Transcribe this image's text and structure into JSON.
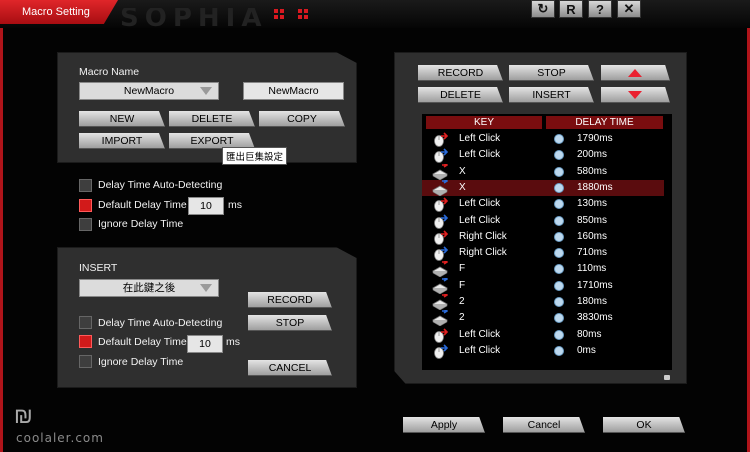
{
  "window": {
    "title": "Macro Setting",
    "logo": "SOPHIA",
    "controls": [
      {
        "name": "refresh-icon",
        "glyph": "↻"
      },
      {
        "name": "r-icon",
        "glyph": "R"
      },
      {
        "name": "help-icon",
        "glyph": "?"
      },
      {
        "name": "close-icon",
        "glyph": "✕"
      }
    ]
  },
  "macro": {
    "name_label": "Macro Name",
    "selected_macro": "NewMacro",
    "name_value": "NewMacro",
    "buttons": {
      "new": "NEW",
      "delete": "DELETE",
      "copy": "COPY",
      "import": "IMPORT",
      "export": "EXPORT"
    },
    "tooltip": "匯出巨集設定"
  },
  "record_options": {
    "auto_detect_label": "Delay Time Auto-Detecting",
    "default_delay_label": "Default Delay Time",
    "default_delay_value": "10",
    "ms": "ms",
    "ignore_delay_label": "Ignore Delay Time"
  },
  "insert": {
    "label": "INSERT",
    "position": "在此鍵之後",
    "auto_detect_label": "Delay Time Auto-Detecting",
    "default_delay_label": "Default Delay Time",
    "default_delay_value": "10",
    "ms": "ms",
    "ignore_delay_label": "Ignore Delay Time",
    "buttons": {
      "record": "RECORD",
      "stop": "STOP",
      "cancel": "CANCEL"
    }
  },
  "editor": {
    "buttons": {
      "record": "RECORD",
      "stop": "STOP",
      "delete": "DELETE",
      "insert": "INSERT"
    },
    "columns": {
      "key": "KEY",
      "delay": "DELAY TIME"
    },
    "rows": [
      {
        "icon": "mouse-down",
        "key": "Left Click",
        "delay": "1790ms"
      },
      {
        "icon": "mouse-up",
        "key": "Left Click",
        "delay": "200ms"
      },
      {
        "icon": "key-down",
        "key": "X",
        "delay": "580ms"
      },
      {
        "icon": "key-up",
        "key": "X",
        "delay": "1880ms",
        "selected": true
      },
      {
        "icon": "mouse-down",
        "key": "Left Click",
        "delay": "130ms"
      },
      {
        "icon": "mouse-up",
        "key": "Left Click",
        "delay": "850ms"
      },
      {
        "icon": "mouse-down",
        "key": "Right Click",
        "delay": "160ms"
      },
      {
        "icon": "mouse-up",
        "key": "Right Click",
        "delay": "710ms"
      },
      {
        "icon": "key-down",
        "key": "F",
        "delay": "110ms"
      },
      {
        "icon": "key-up",
        "key": "F",
        "delay": "1710ms"
      },
      {
        "icon": "key-down",
        "key": "2",
        "delay": "180ms"
      },
      {
        "icon": "key-up",
        "key": "2",
        "delay": "3830ms"
      },
      {
        "icon": "mouse-down",
        "key": "Left Click",
        "delay": "80ms"
      },
      {
        "icon": "mouse-up",
        "key": "Left Click",
        "delay": "0ms"
      }
    ]
  },
  "footer": {
    "apply": "Apply",
    "cancel": "Cancel",
    "ok": "OK"
  },
  "watermark": "coolaler.com",
  "colors": {
    "accent": "#d81920",
    "panel": "#2f2f2f",
    "selected_row": "#5a0c0e"
  }
}
